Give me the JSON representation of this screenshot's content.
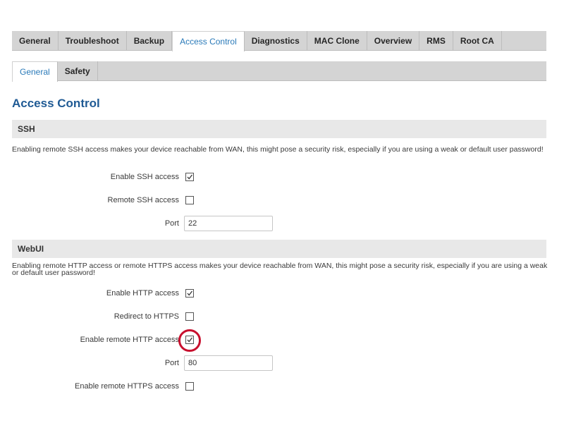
{
  "tabs": [
    {
      "label": "General",
      "active": false
    },
    {
      "label": "Troubleshoot",
      "active": false
    },
    {
      "label": "Backup",
      "active": false
    },
    {
      "label": "Access Control",
      "active": true
    },
    {
      "label": "Diagnostics",
      "active": false
    },
    {
      "label": "MAC Clone",
      "active": false
    },
    {
      "label": "Overview",
      "active": false
    },
    {
      "label": "RMS",
      "active": false
    },
    {
      "label": "Root CA",
      "active": false
    }
  ],
  "subtabs": [
    {
      "label": "General",
      "active": true
    },
    {
      "label": "Safety",
      "active": false
    }
  ],
  "page_title": "Access Control",
  "ssh": {
    "heading": "SSH",
    "description": "Enabling remote SSH access makes your device reachable from WAN, this might pose a security risk, especially if you are using a weak or default user password!",
    "enable_ssh": {
      "label": "Enable SSH access",
      "checked": true
    },
    "remote_ssh": {
      "label": "Remote SSH access",
      "checked": false
    },
    "port": {
      "label": "Port",
      "value": "22"
    }
  },
  "webui": {
    "heading": "WebUI",
    "description": "Enabling remote HTTP access or remote HTTPS access makes your device reachable from WAN, this might pose a security risk, especially if you are using a weak or default user password!",
    "enable_http": {
      "label": "Enable HTTP access",
      "checked": true
    },
    "redirect_https": {
      "label": "Redirect to HTTPS",
      "checked": false
    },
    "remote_http": {
      "label": "Enable remote HTTP access",
      "checked": true
    },
    "port": {
      "label": "Port",
      "value": "80"
    },
    "remote_https": {
      "label": "Enable remote HTTPS access",
      "checked": false
    }
  },
  "colors": {
    "accent": "#2a7ab9",
    "title": "#1f5a94",
    "highlight": "#c8102e"
  }
}
